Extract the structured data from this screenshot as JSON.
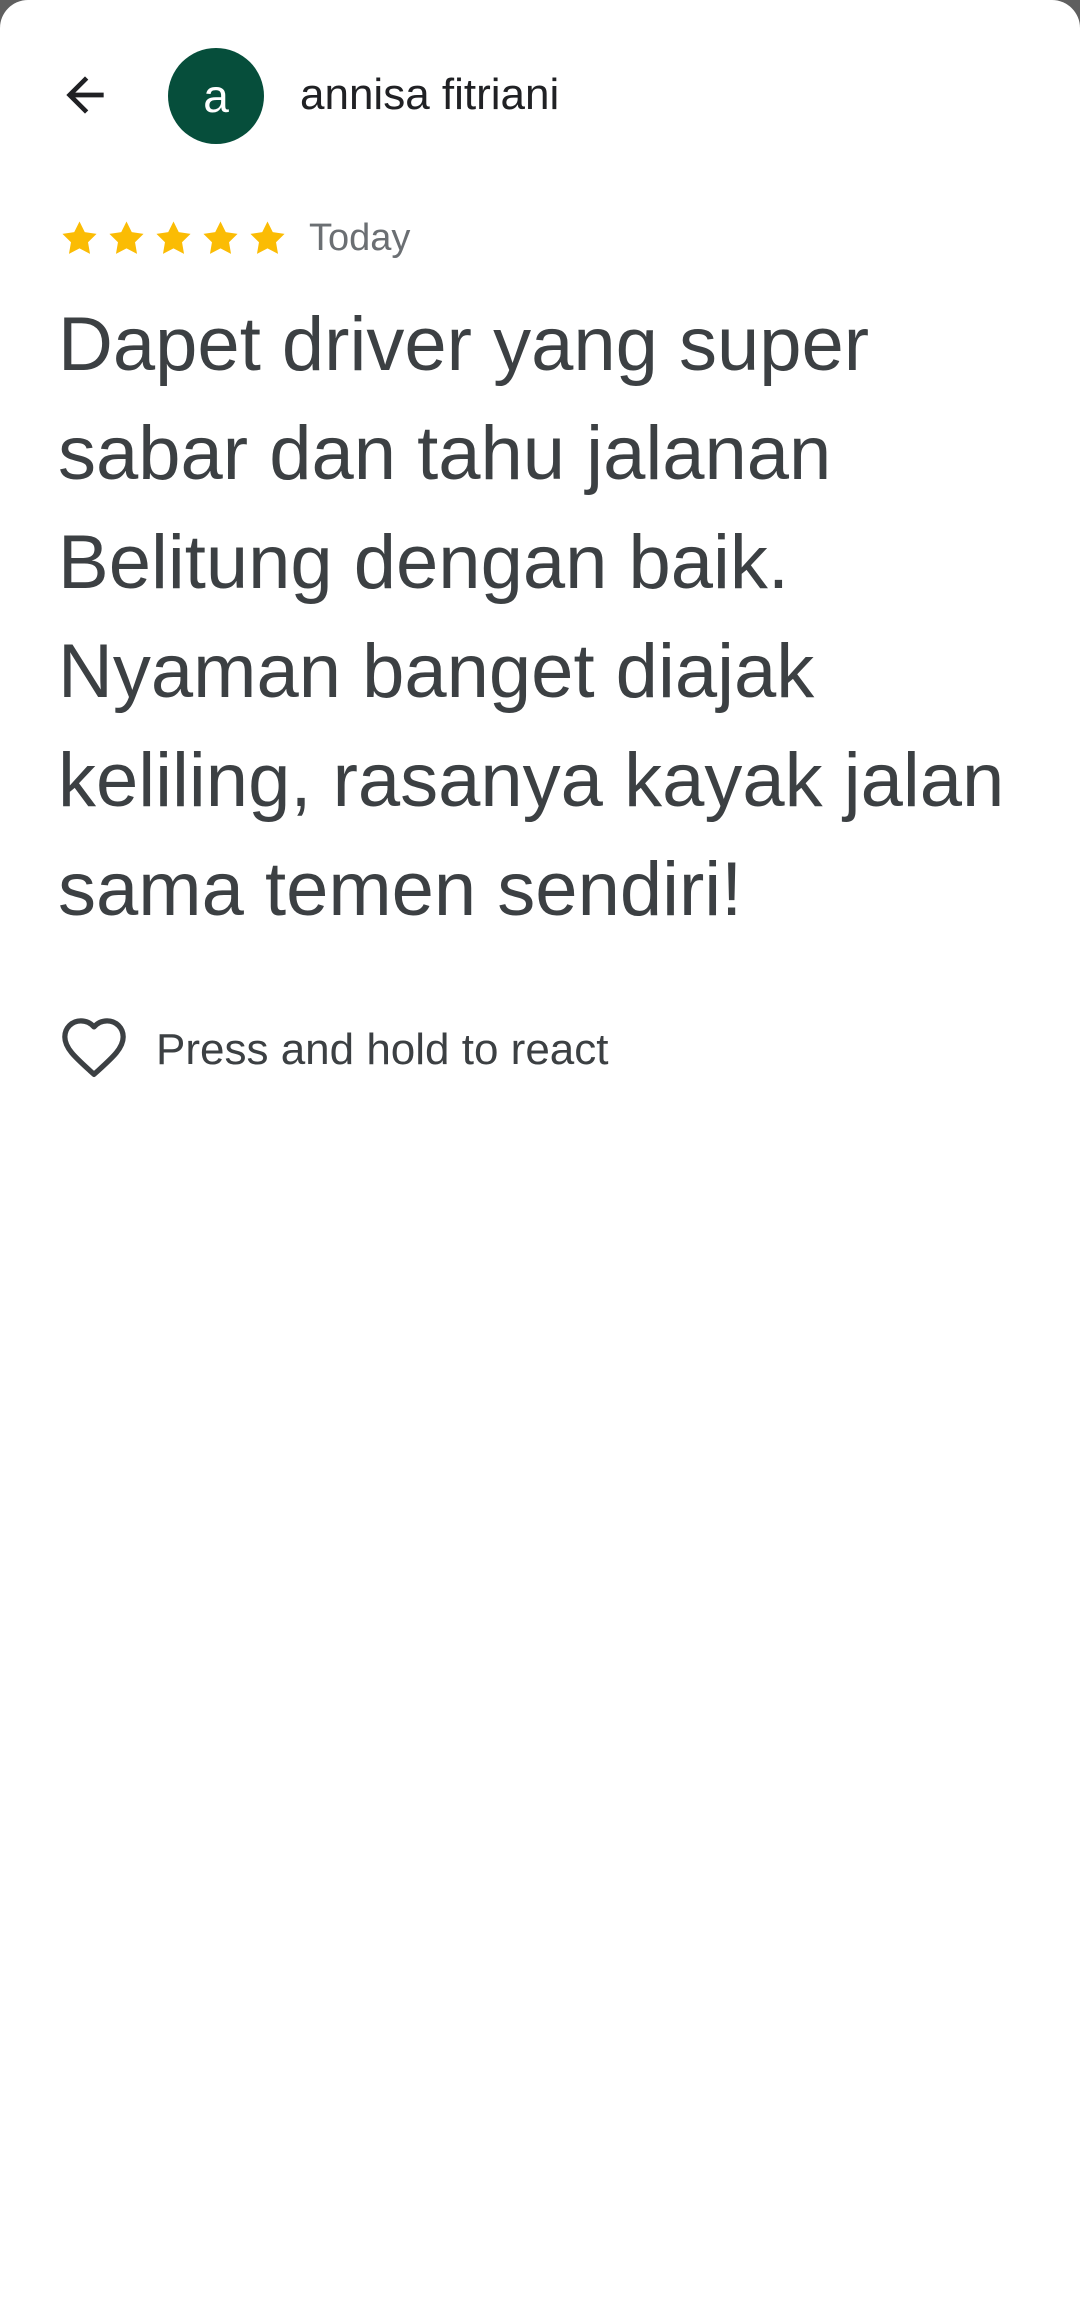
{
  "header": {
    "back_icon": "arrow-left-icon",
    "avatar_initial": "a",
    "avatar_color": "#064e3b",
    "author_name": "annisa fitriani"
  },
  "review": {
    "rating": 5,
    "rating_max": 5,
    "star_color": "#fbbc04",
    "date": "Today",
    "text": "Dapet driver yang super sabar dan tahu jalanan Belitung dengan baik. Nyaman banget diajak keliling, rasanya kayak jalan sama temen sendiri!"
  },
  "reaction": {
    "icon": "heart-outline-icon",
    "label": "Press and hold to react"
  }
}
